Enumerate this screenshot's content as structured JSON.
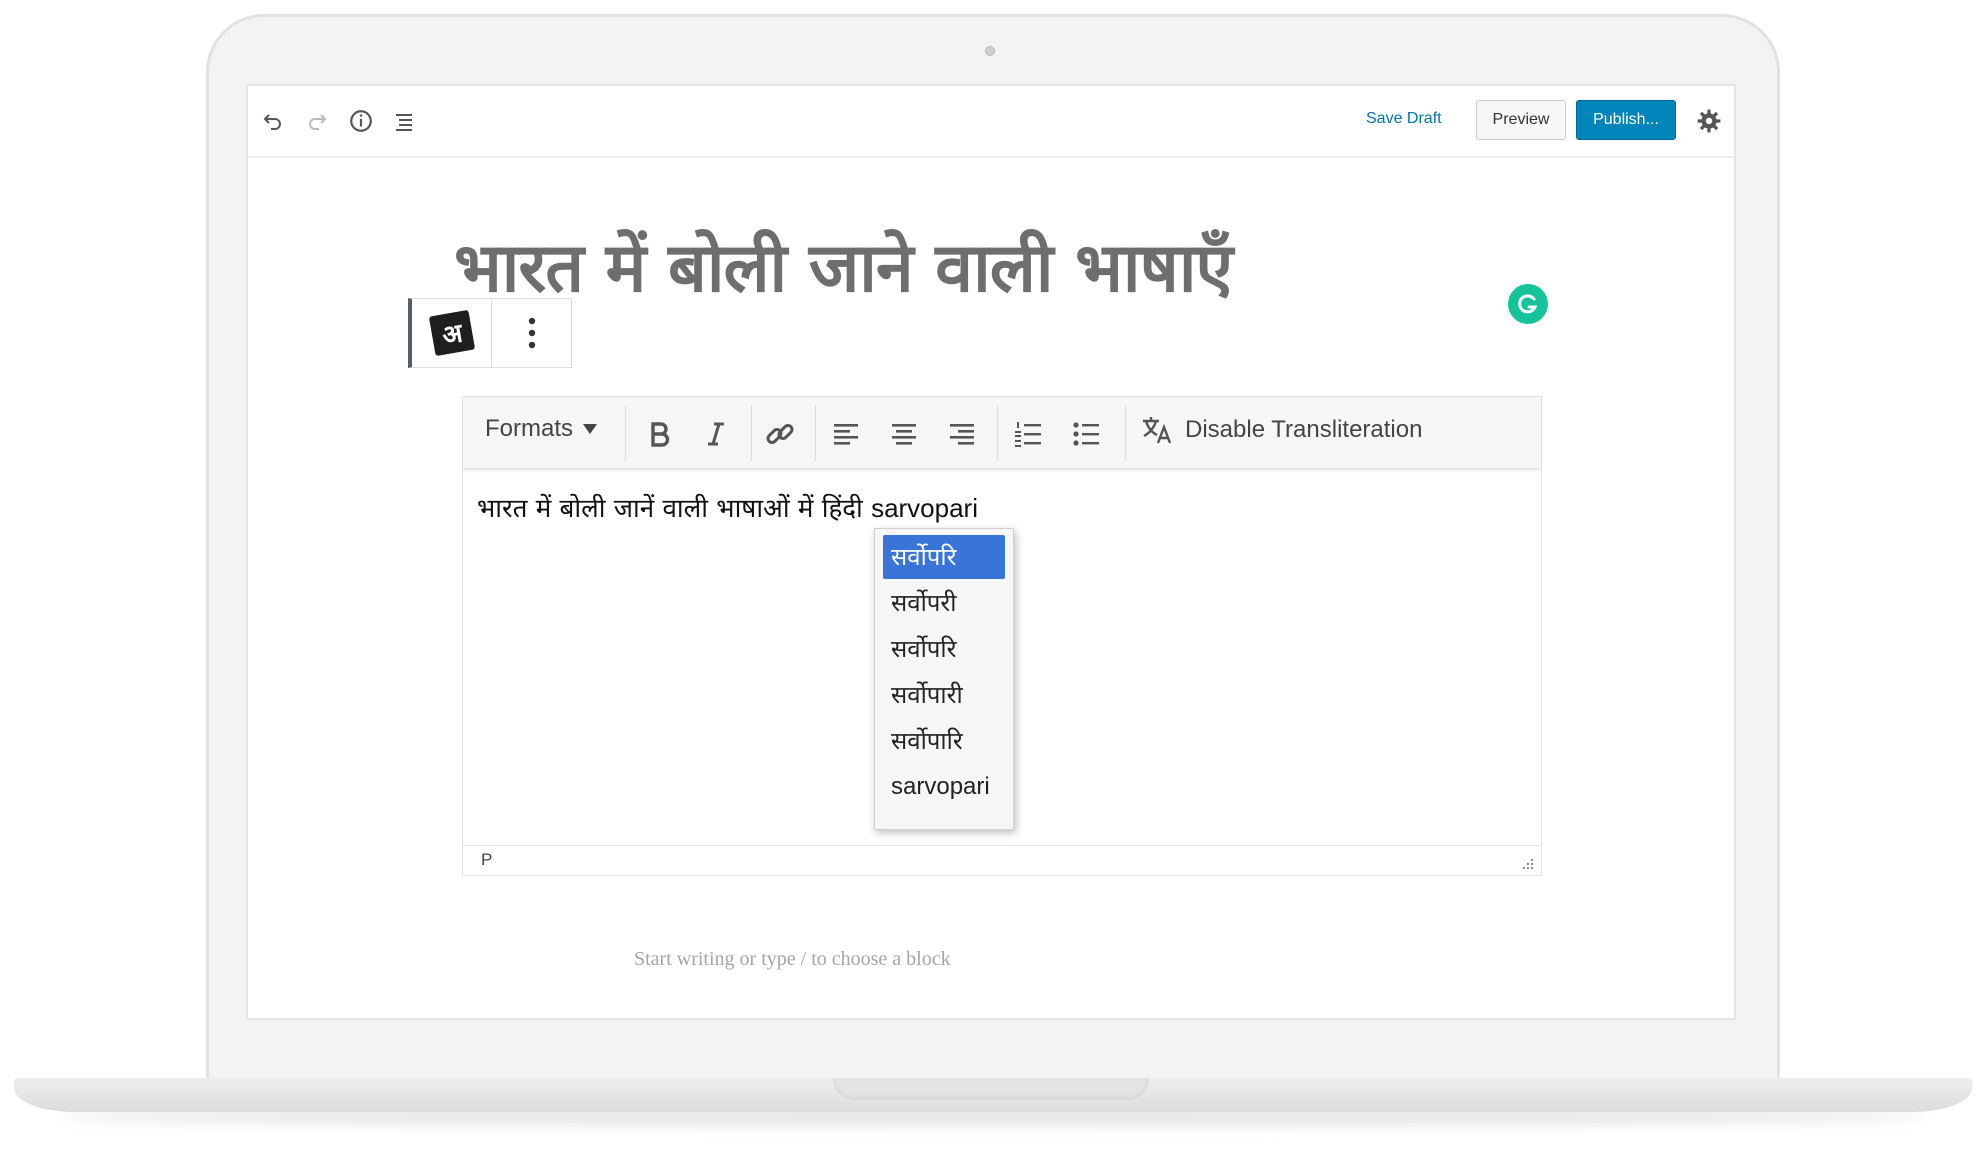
{
  "toolbar": {
    "save_draft": "Save Draft",
    "preview": "Preview",
    "publish": "Publish...",
    "icons": [
      "undo-icon",
      "redo-icon",
      "info-icon",
      "outline-icon",
      "gear-icon"
    ]
  },
  "post": {
    "title": "भारत में बोली जाने वाली भाषाएँ"
  },
  "block_toolbar": {
    "badge": "अ"
  },
  "editor": {
    "formats_label": "Formats",
    "disable_transliteration": "Disable Transliteration",
    "content_hindi": "भारत में बोली जानें वाली भाषाओं में हिंदी",
    "content_latin": "sarvopari",
    "path": "P"
  },
  "suggestions": [
    {
      "text": "सर्वोपरि",
      "selected": true
    },
    {
      "text": "सर्वोपरी",
      "selected": false
    },
    {
      "text": "सर्वोपरि",
      "selected": false
    },
    {
      "text": "सर्वोपारी",
      "selected": false
    },
    {
      "text": "सर्वोपारि",
      "selected": false
    },
    {
      "text": "sarvopari",
      "selected": false
    }
  ],
  "placeholder": "Start writing or type / to choose a block",
  "colors": {
    "accent": "#0085ba",
    "link": "#0073aa",
    "selection": "#3875d7",
    "grammarly": "#15c39a"
  }
}
